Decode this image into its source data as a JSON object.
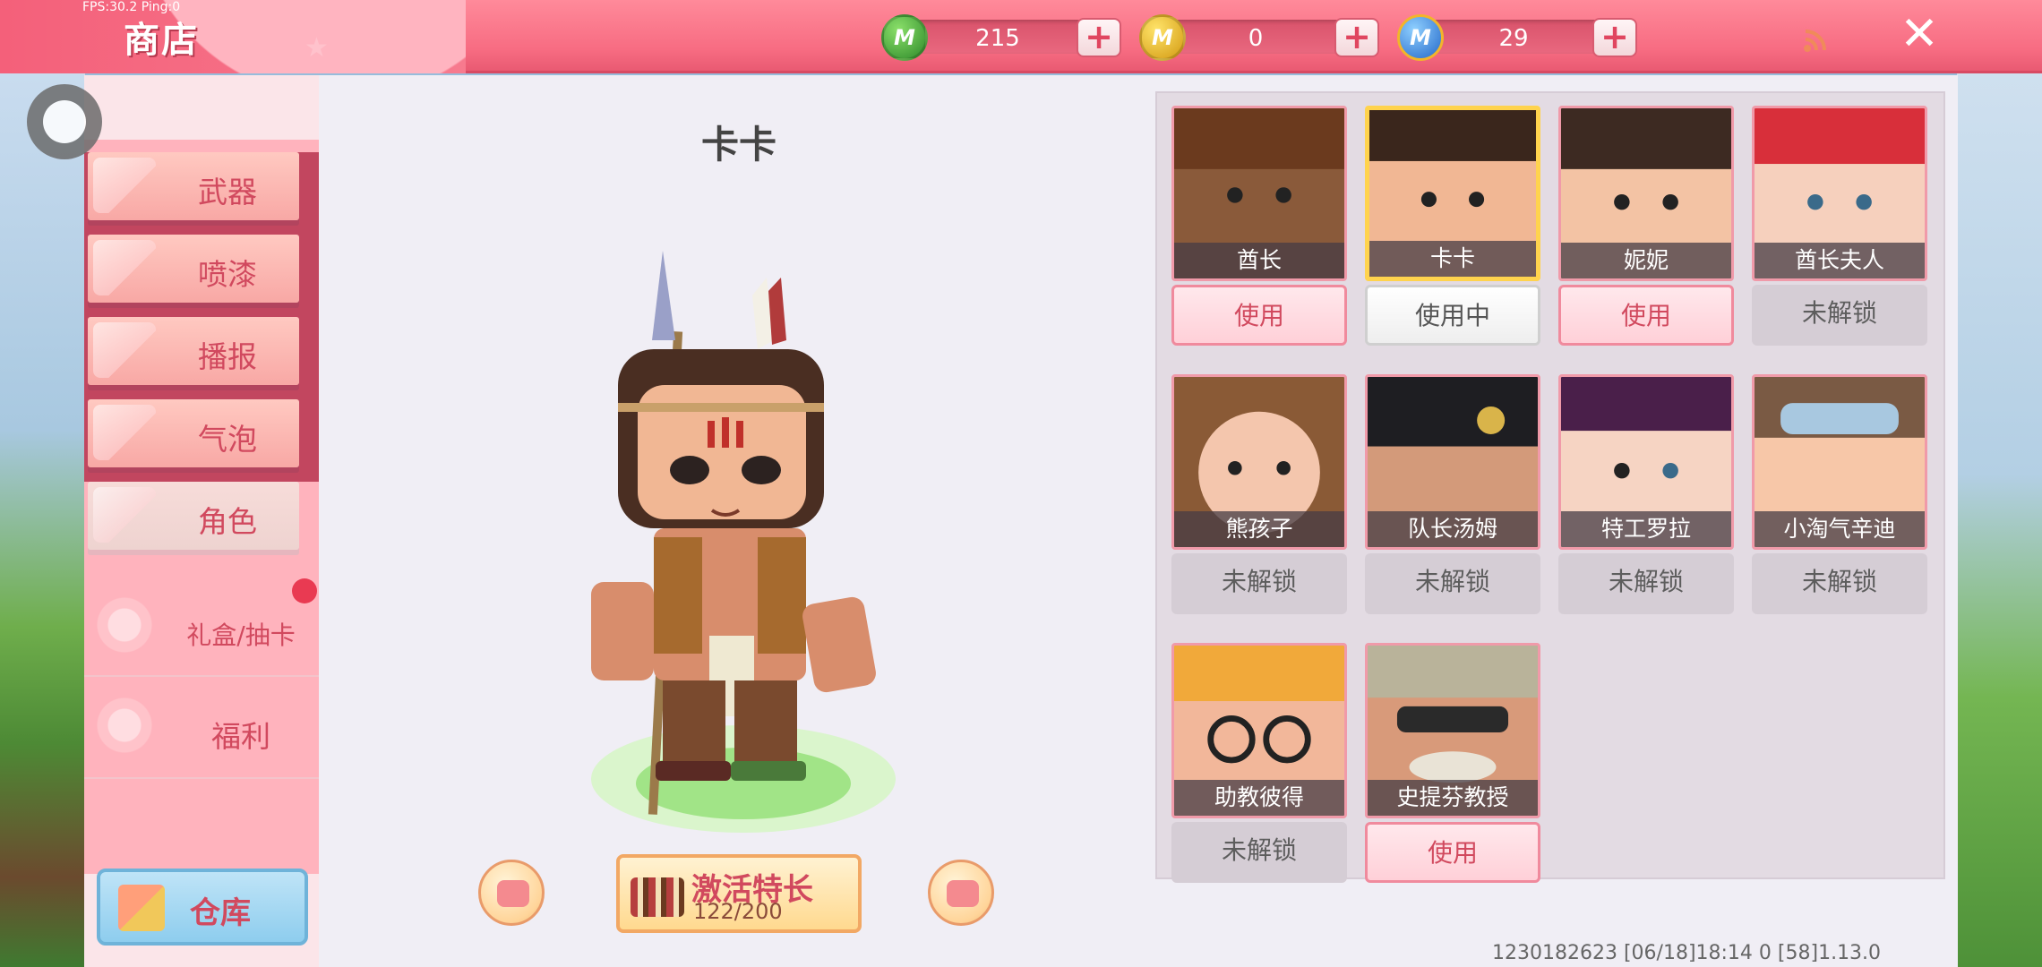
{
  "status": {
    "fps_text": "FPS:30.2  Ping:0"
  },
  "header": {
    "title": "商店"
  },
  "currencies": [
    {
      "icon": "green-mini-coin-icon",
      "color": "#3a9a35",
      "value": "215"
    },
    {
      "icon": "gold-mini-coin-icon",
      "color": "#e2b11d",
      "value": "0"
    },
    {
      "icon": "blue-mini-bean-icon",
      "color": "#3a86d8",
      "value": "29"
    }
  ],
  "sidebar": {
    "tabs": [
      {
        "label": "武器",
        "icon": "pistol-icon"
      },
      {
        "label": "喷漆",
        "icon": "spray-can-icon"
      },
      {
        "label": "播报",
        "icon": "broadcast-box-icon"
      },
      {
        "label": "气泡",
        "icon": "bubble-box-icon"
      },
      {
        "label": "角色",
        "icon": "character-icon",
        "active": true
      },
      {
        "label": "礼盒/抽卡",
        "icon": "gift-wheel-icon"
      },
      {
        "label": "福利",
        "icon": "gift-icon"
      }
    ],
    "warehouse_label": "仓库"
  },
  "preview": {
    "character_name": "卡卡",
    "activate_label": "激活特长",
    "activate_progress": "122/200"
  },
  "roster": [
    {
      "name": "酋长",
      "action": "使用",
      "state": "use",
      "skin": "#8a5a3a",
      "hair": "#6b3a1e"
    },
    {
      "name": "卡卡",
      "action": "使用中",
      "state": "inuse",
      "skin": "#f1b794",
      "hair": "#3a261c",
      "selected": true
    },
    {
      "name": "妮妮",
      "action": "使用",
      "state": "use",
      "skin": "#f3c3a4",
      "hair": "#3d2a22"
    },
    {
      "name": "酋长夫人",
      "action": "未解锁",
      "state": "locked",
      "skin": "#f6d0bd",
      "hair": "#d82f3a"
    },
    {
      "name": "熊孩子",
      "action": "未解锁",
      "state": "locked",
      "skin": "#f4c6ad",
      "hair": "#8a5a36"
    },
    {
      "name": "队长汤姆",
      "action": "未解锁",
      "state": "locked",
      "skin": "#d39a7a",
      "hair": "#1e1e22"
    },
    {
      "name": "特工罗拉",
      "action": "未解锁",
      "state": "locked",
      "skin": "#f6d4c3",
      "hair": "#4a1f4a"
    },
    {
      "name": "小淘气辛迪",
      "action": "未解锁",
      "state": "locked",
      "skin": "#f7c7a8",
      "hair": "#e07a2e"
    },
    {
      "name": "助教彼得",
      "action": "未解锁",
      "state": "locked",
      "skin": "#f2b79a",
      "hair": "#f1a93a"
    },
    {
      "name": "史提芬教授",
      "action": "使用",
      "state": "use",
      "skin": "#d89a7a",
      "hair": "#e9e3d6"
    }
  ],
  "footer": {
    "build_info": "1230182623    [06/18]18:14 0    [58]1.13.0"
  }
}
